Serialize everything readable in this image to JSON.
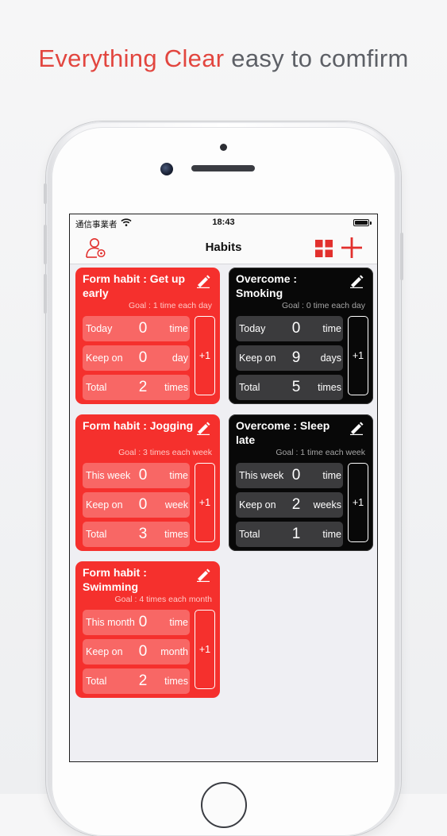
{
  "headline": {
    "highlight": "Everything Clear",
    "rest": "easy to comfirm"
  },
  "status_bar": {
    "carrier": "通信事業者",
    "time": "18:43"
  },
  "nav": {
    "title": "Habits"
  },
  "habits": [
    {
      "title": "Form habit : Get up early",
      "goal": "Goal : 1 time each day",
      "rows": [
        {
          "label": "Today",
          "value": "0",
          "unit": "time"
        },
        {
          "label": "Keep on",
          "value": "0",
          "unit": "day"
        },
        {
          "label": "Total",
          "value": "2",
          "unit": "times"
        }
      ]
    },
    {
      "title": "Overcome : Smoking",
      "goal": "Goal : 0 time each day",
      "rows": [
        {
          "label": "Today",
          "value": "0",
          "unit": "time"
        },
        {
          "label": "Keep on",
          "value": "9",
          "unit": "days"
        },
        {
          "label": "Total",
          "value": "5",
          "unit": "times"
        }
      ]
    },
    {
      "title": "Form habit : Jogging",
      "goal": "Goal : 3 times each week",
      "rows": [
        {
          "label": "This week",
          "value": "0",
          "unit": "time"
        },
        {
          "label": "Keep on",
          "value": "0",
          "unit": "week"
        },
        {
          "label": "Total",
          "value": "3",
          "unit": "times"
        }
      ]
    },
    {
      "title": "Overcome : Sleep late",
      "goal": "Goal : 1 time each week",
      "rows": [
        {
          "label": "This week",
          "value": "0",
          "unit": "time"
        },
        {
          "label": "Keep on",
          "value": "2",
          "unit": "weeks"
        },
        {
          "label": "Total",
          "value": "1",
          "unit": "time"
        }
      ]
    },
    {
      "title": "Form habit : Swimming",
      "goal": "Goal : 4 times each month",
      "rows": [
        {
          "label": "This month",
          "value": "0",
          "unit": "time"
        },
        {
          "label": "Keep on",
          "value": "0",
          "unit": "month"
        },
        {
          "label": "Total",
          "value": "2",
          "unit": "times"
        }
      ]
    }
  ],
  "increment_label": "+1",
  "colors": {
    "accent_red": "#f5302d",
    "headline_red": "#e2463f",
    "headline_gray": "#5d6066",
    "card_black": "#080808"
  }
}
